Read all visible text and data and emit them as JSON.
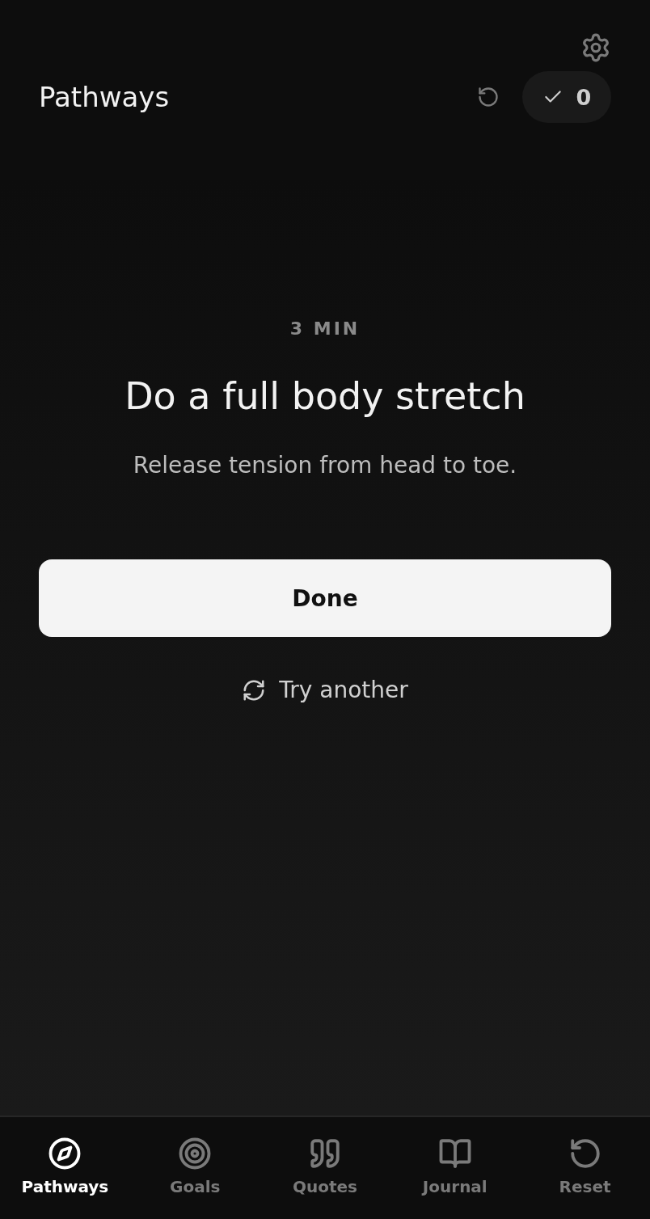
{
  "header": {
    "title": "Pathways",
    "completed_count": "0"
  },
  "task": {
    "duration": "3 MIN",
    "title": "Do a full body stretch",
    "description": "Release tension from head to toe."
  },
  "done_button": "Done",
  "try_another": "Try another",
  "nav": [
    {
      "label": "Pathways",
      "selected": true
    },
    {
      "label": "Goals",
      "selected": false
    },
    {
      "label": "Quotes",
      "selected": false
    },
    {
      "label": "Journal",
      "selected": false
    },
    {
      "label": "Reset",
      "selected": false
    }
  ]
}
